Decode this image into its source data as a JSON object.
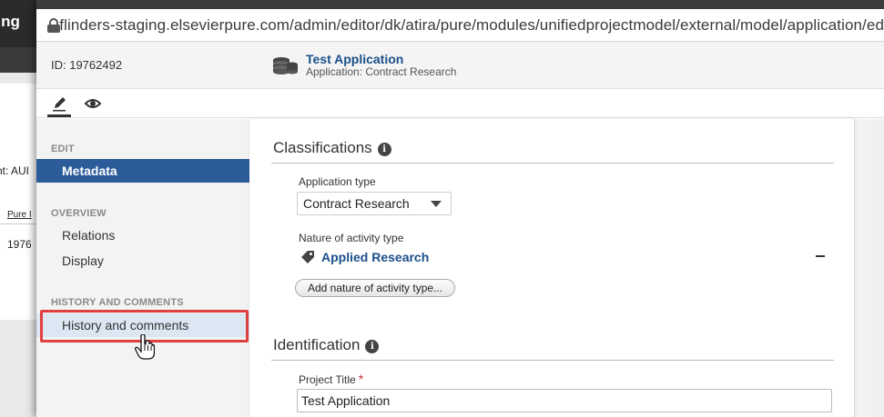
{
  "background": {
    "brand": "ging",
    "partial_text_1": "nt: AUI",
    "partial_link": "Pure I",
    "partial_text_2": "1976"
  },
  "browser": {
    "url": "flinders-staging.elsevierpure.com/admin/editor/dk/atira/pure/modules/unifiedprojectmodel/external/model/application/ed"
  },
  "header": {
    "record_id": "ID: 19762492",
    "title": "Test Application",
    "subtitle": "Application: Contract Research"
  },
  "sidebar": {
    "sections": [
      {
        "heading": "EDIT",
        "items": [
          {
            "label": "Metadata",
            "active": true
          }
        ]
      },
      {
        "heading": "OVERVIEW",
        "items": [
          {
            "label": "Relations"
          },
          {
            "label": "Display"
          }
        ]
      },
      {
        "heading": "HISTORY AND COMMENTS",
        "items": [
          {
            "label": "History and comments",
            "hovered": true
          }
        ]
      }
    ]
  },
  "classifications": {
    "title": "Classifications",
    "application_type_label": "Application type",
    "application_type_value": "Contract Research",
    "nature_label": "Nature of activity type",
    "nature_value": "Applied Research",
    "add_button_label": "Add nature of activity type..."
  },
  "identification": {
    "title": "Identification",
    "project_title_label": "Project Title",
    "required_marker": "*",
    "project_title_value": "Test Application"
  },
  "colors": {
    "accent": "#2d5c9b",
    "link": "#1a4f8a",
    "highlight": "#e04040",
    "required": "#c0392b"
  },
  "icons": [
    "lock-icon",
    "application-icon",
    "pencil-icon",
    "eye-icon",
    "info-icon",
    "tag-icon",
    "minus-icon",
    "hand-cursor-icon"
  ]
}
